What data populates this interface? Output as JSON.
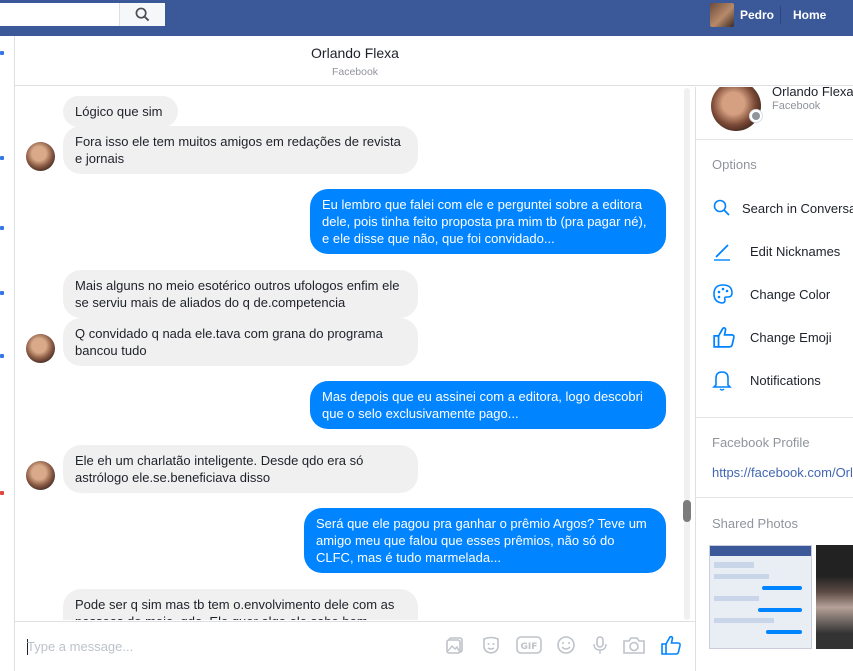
{
  "topbar": {
    "profile_name": "Pedro",
    "home_label": "Home"
  },
  "header": {
    "contact_name": "Orlando Flexa",
    "contact_source": "Facebook"
  },
  "messages": [
    {
      "dir": "in",
      "text": "Lógico que sim"
    },
    {
      "dir": "in",
      "text": "Fora isso ele tem muitos amigos em redações de revista e jornais"
    },
    {
      "dir": "out",
      "text": "Eu lembro que falei com ele e perguntei sobre a editora dele, pois tinha feito proposta pra mim tb (pra pagar né), e ele disse que não, que foi convidado..."
    },
    {
      "dir": "in",
      "text": "Mais alguns no meio esotérico outros ufologos enfim ele se serviu mais de aliados do q de.competencia"
    },
    {
      "dir": "in",
      "text": "Q convidado q nada ele.tava com grana do programa bancou tudo"
    },
    {
      "dir": "out",
      "text": "Mas depois que eu assinei com a editora, logo descobri que o selo exclusivamente pago..."
    },
    {
      "dir": "in",
      "text": "Ele eh um charlatão inteligente. Desde qdo era só astrólogo ele.se.beneficiava disso"
    },
    {
      "dir": "out",
      "text": "Será que ele pagou pra ganhar o prêmio Argos? Teve um amigo meu que falou que esses prêmios, não só do CLFC, mas é tudo marmelada..."
    },
    {
      "dir": "in",
      "text": "Pode ser q sim mas tb tem o.envolvimento dele com as pessoas do meio, qdo. Ele quer algo ele sabe bem"
    }
  ],
  "composer": {
    "placeholder": "Type a message..."
  },
  "right_panel": {
    "name": "Orlando Flexa",
    "source": "Facebook",
    "options_heading": "Options",
    "options": [
      {
        "label": "Search in Conversation",
        "icon": "search-icon"
      },
      {
        "label": "Edit Nicknames",
        "icon": "pencil-icon"
      },
      {
        "label": "Change Color",
        "icon": "palette-icon"
      },
      {
        "label": "Change Emoji",
        "icon": "thumbs-up-icon"
      },
      {
        "label": "Notifications",
        "icon": "bell-icon"
      }
    ],
    "profile_heading": "Facebook Profile",
    "profile_link": "https://facebook.com/Orlando",
    "photos_heading": "Shared Photos"
  },
  "colors": {
    "brand": "#3b5998",
    "outgoing_bubble": "#0084ff",
    "incoming_bubble": "#f1f0f0",
    "link": "#4267b2"
  }
}
